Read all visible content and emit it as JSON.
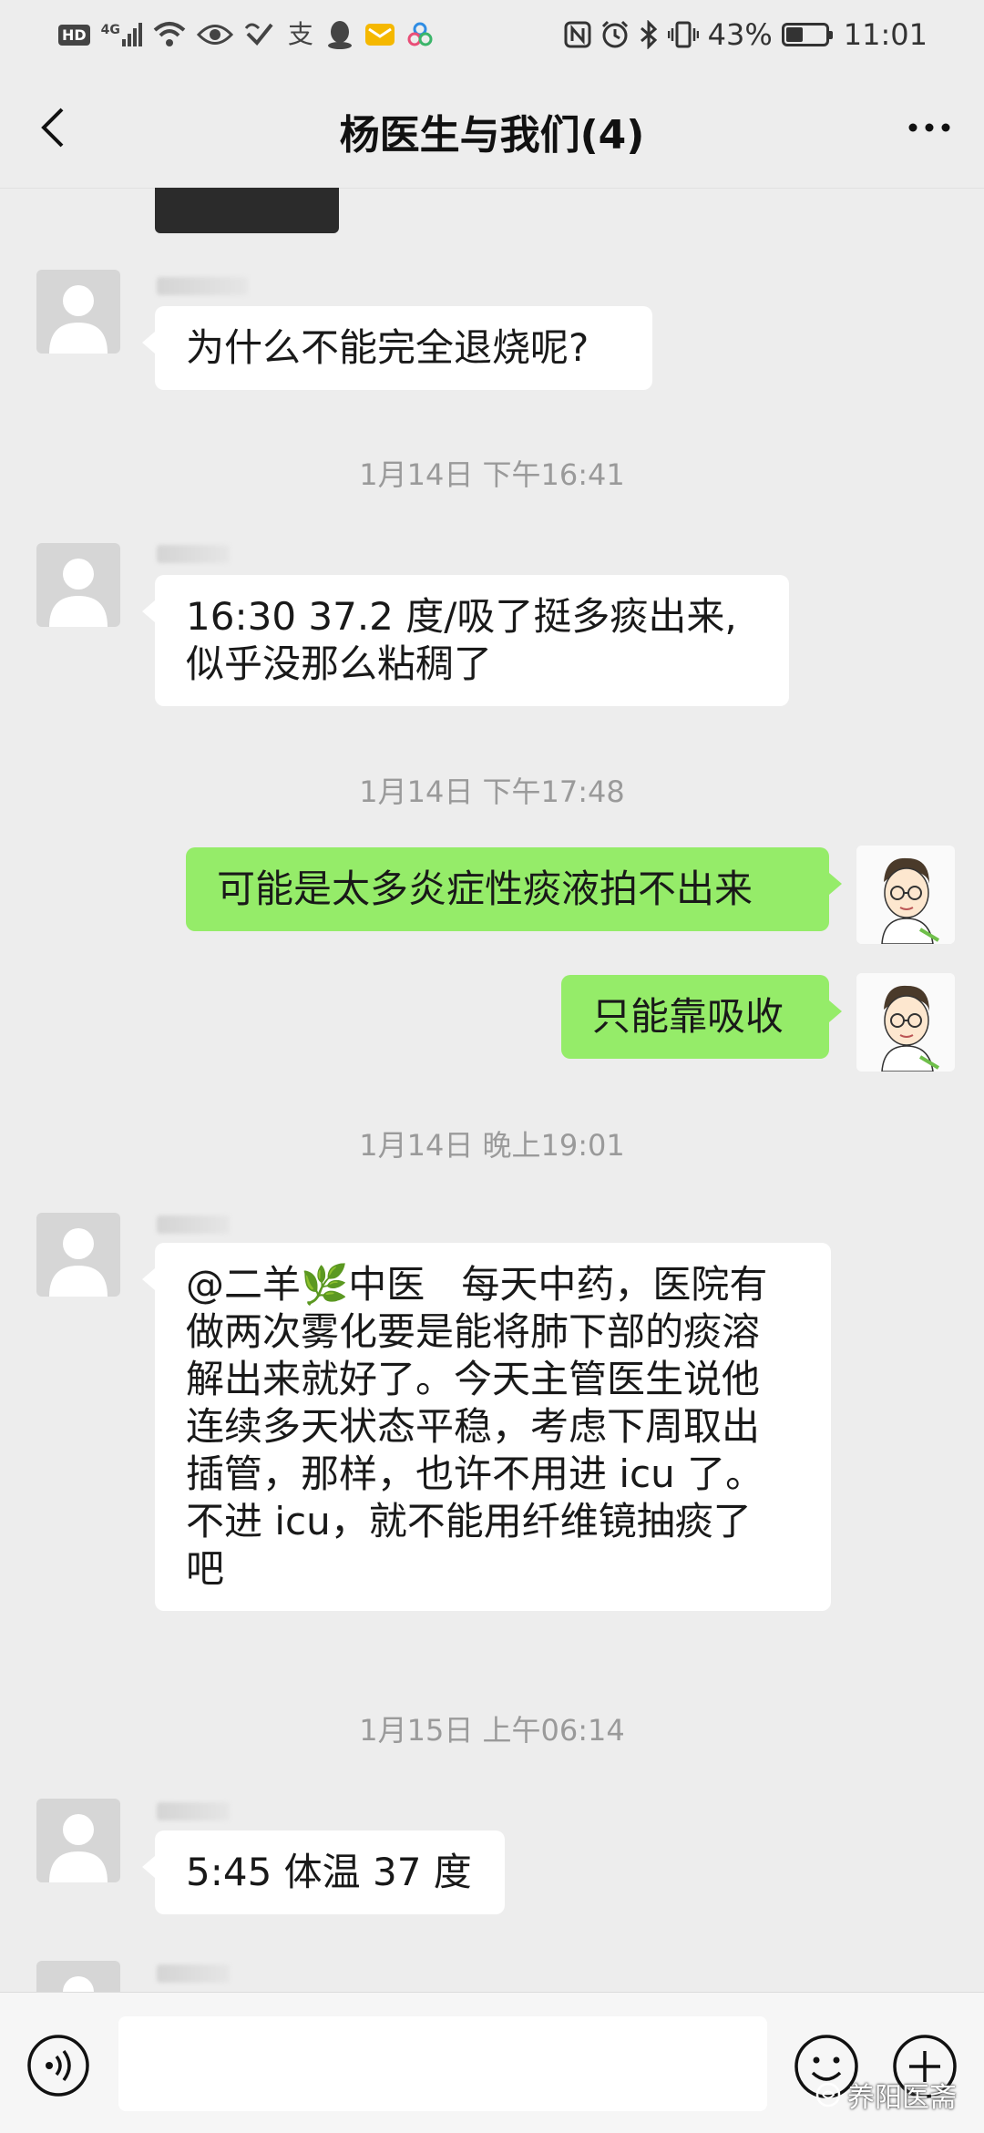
{
  "status_bar": {
    "left_icons": [
      "hd-icon",
      "signal-4g-icon",
      "wifi-icon",
      "eye-icon",
      "check-heart-icon",
      "alipay-icon",
      "qq-icon",
      "mail-icon",
      "app-icon"
    ],
    "hd": "HD",
    "net": "4G",
    "battery": "43%",
    "battery_level": 0.43,
    "time": "11:01"
  },
  "nav": {
    "title": "杨医生与我们(4)"
  },
  "messages": [
    {
      "type": "image",
      "side": "left"
    },
    {
      "type": "text",
      "side": "left",
      "text": "为什么不能完全退烧呢?"
    },
    {
      "type": "time",
      "text": "1月14日 下午16:41"
    },
    {
      "type": "text",
      "side": "left",
      "text": "16:30 37.2 度/吸了挺多痰出来,\n似乎没那么粘稠了"
    },
    {
      "type": "time",
      "text": "1月14日 下午17:48"
    },
    {
      "type": "text",
      "side": "right",
      "text": "可能是太多炎症性痰液拍不出来"
    },
    {
      "type": "text",
      "side": "right",
      "text": "只能靠吸收"
    },
    {
      "type": "time",
      "text": "1月14日 晚上19:01"
    },
    {
      "type": "text",
      "side": "left",
      "text": "@二羊🌿中医   每天中药，医院有\n做两次雾化要是能将肺下部的痰溶\n解出来就好了。今天主管医生说他\n连续多天状态平稳，考虑下周取出\n插管，那样，也许不用进 icu 了。\n不进 icu，就不能用纤维镜抽痰了\n吧"
    },
    {
      "type": "time",
      "text": "1月15日 上午06:14"
    },
    {
      "type": "text",
      "side": "left",
      "text": "5:45 体温 37 度"
    }
  ],
  "input_bar": {
    "placeholder": "",
    "voice_icon": "voice-icon",
    "emoji_icon": "emoji-icon",
    "plus_icon": "plus-icon"
  },
  "watermark": "养阳医斋",
  "colors": {
    "background": "#ededed",
    "bubble_self": "#95ec69",
    "bubble_other": "#ffffff",
    "timestamp": "#9a9a9a"
  }
}
